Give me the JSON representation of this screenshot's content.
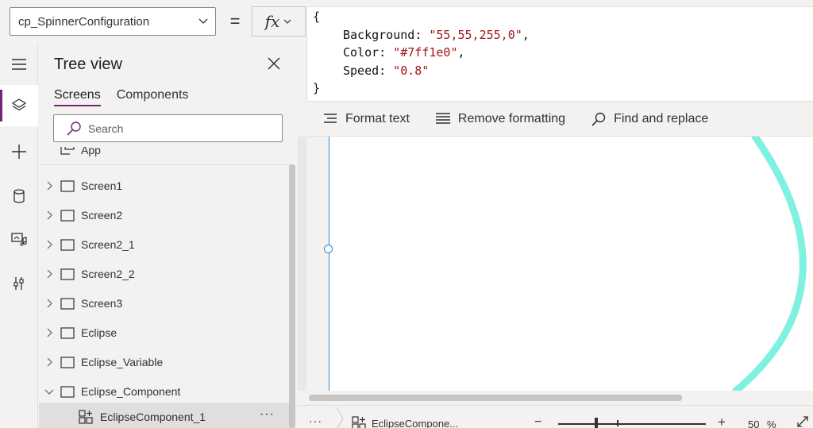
{
  "formula_bar": {
    "property": "cp_SpinnerConfiguration",
    "equals": "=",
    "fx_label": "fx",
    "code": {
      "open": "{",
      "close": "}",
      "lines": [
        {
          "key": "Background",
          "value": "\"55,55,255,0\"",
          "trail": ","
        },
        {
          "key": "Color",
          "value": "\"#7ff1e0\"",
          "trail": ","
        },
        {
          "key": "Speed",
          "value": "\"0.8\"",
          "trail": ""
        }
      ]
    }
  },
  "format_toolbar": {
    "format_text": "Format text",
    "remove_formatting": "Remove formatting",
    "find_replace": "Find and replace"
  },
  "left_rail": {
    "items": [
      "menu-icon",
      "layers-icon",
      "plus-icon",
      "database-icon",
      "media-icon",
      "tools-icon"
    ],
    "active": "layers-icon"
  },
  "tree_view": {
    "title": "Tree view",
    "tabs": [
      {
        "label": "Screens",
        "active": true
      },
      {
        "label": "Components",
        "active": false
      }
    ],
    "search_placeholder": "Search",
    "app_label": "App",
    "items": [
      {
        "label": "Screen1",
        "expanded": false
      },
      {
        "label": "Screen2",
        "expanded": false
      },
      {
        "label": "Screen2_1",
        "expanded": false
      },
      {
        "label": "Screen2_2",
        "expanded": false
      },
      {
        "label": "Screen3",
        "expanded": false
      },
      {
        "label": "Eclipse",
        "expanded": false
      },
      {
        "label": "Eclipse_Variable",
        "expanded": false
      },
      {
        "label": "Eclipse_Component",
        "expanded": true
      }
    ],
    "child": {
      "label": "EclipseComponent_1",
      "more": "···",
      "selected": true
    }
  },
  "canvas": {
    "spinner_color": "#7ff1e0",
    "selection_color": "#2b88d8"
  },
  "status_bar": {
    "more": "···",
    "breadcrumb": "EclipseCompone...",
    "zoom_minus": "−",
    "zoom_plus": "+",
    "zoom_value": "50",
    "zoom_unit": "%"
  }
}
